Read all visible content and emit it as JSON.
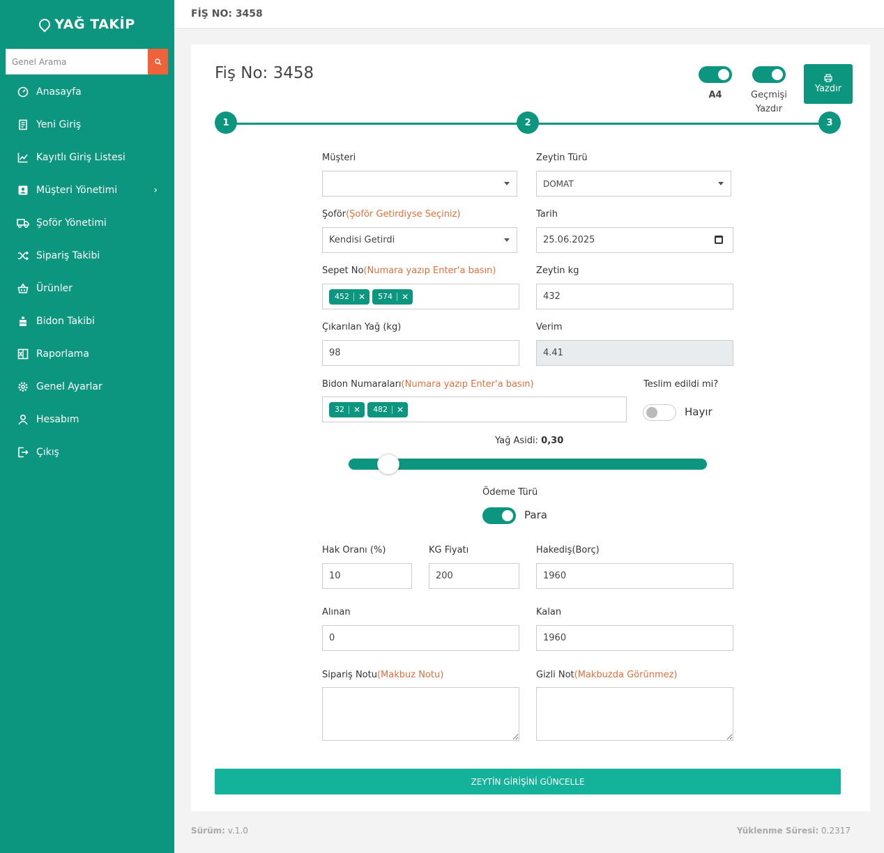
{
  "brand": {
    "name": "YAĞ TAKİP"
  },
  "search": {
    "placeholder": "Genel Arama"
  },
  "sidebar": {
    "items": [
      {
        "label": "Anasayfa",
        "icon": "dashboard-icon"
      },
      {
        "label": "Yeni Giriş",
        "icon": "receipt-icon"
      },
      {
        "label": "Kayıtlı Giriş Listesi",
        "icon": "chart-line-icon"
      },
      {
        "label": "Müşteri Yönetimi",
        "icon": "user-card-icon",
        "has_submenu": true
      },
      {
        "label": "Şoför Yönetimi",
        "icon": "truck-icon"
      },
      {
        "label": "Sipariş Takibi",
        "icon": "shuffle-icon"
      },
      {
        "label": "Ürünler",
        "icon": "basket-icon"
      },
      {
        "label": "Bidon Takibi",
        "icon": "barrel-icon"
      },
      {
        "label": "Raporlama",
        "icon": "excel-icon"
      },
      {
        "label": "Genel Ayarlar",
        "icon": "gear-icon"
      },
      {
        "label": "Hesabım",
        "icon": "user-icon"
      },
      {
        "label": "Çıkış",
        "icon": "logout-icon"
      }
    ]
  },
  "topbar": {
    "title": "FİŞ NO: 3458"
  },
  "card": {
    "title": "Fiş No: 3458",
    "toggles": {
      "a4": "A4",
      "history_l1": "Geçmişi",
      "history_l2": "Yazdır"
    },
    "print_label": "Yazdır",
    "steps": [
      "1",
      "2",
      "3"
    ]
  },
  "form": {
    "musteri": {
      "label": "Müşteri",
      "value": ""
    },
    "zeytin_turu": {
      "label": "Zeytin Türü",
      "value": "DOMAT"
    },
    "sofor": {
      "label": "Şoför",
      "hint": "(Şoför Getirdiyse Seçiniz)",
      "value": "Kendisi Getirdi"
    },
    "tarih": {
      "label": "Tarih",
      "value": "25.06.2025"
    },
    "sepet_no": {
      "label": "Sepet No",
      "hint": "(Numara yazıp Enter'a basın)",
      "tags": [
        "452",
        "574"
      ]
    },
    "zeytin_kg": {
      "label": "Zeytin kg",
      "value": "432"
    },
    "cikarilan_yag": {
      "label": "Çıkarılan Yağ (kg)",
      "value": "98"
    },
    "verim": {
      "label": "Verim",
      "value": "4.41"
    },
    "bidon": {
      "label": "Bidon Numaraları",
      "hint": "(Numara yazıp Enter'a basın)",
      "tags": [
        "32",
        "482"
      ]
    },
    "teslim": {
      "label": "Teslim edildi mi?",
      "value": "Hayır",
      "checked": false
    },
    "yag_asidi": {
      "label": "Yağ Asidi:",
      "value": "0,30",
      "level_fraction": 0.06
    },
    "odeme": {
      "label": "Ödeme Türü",
      "value": "Para",
      "checked": true
    },
    "hak_orani": {
      "label": "Hak Oranı (%)",
      "value": "10"
    },
    "kg_fiyati": {
      "label": "KG Fiyatı",
      "value": "200"
    },
    "hakedis": {
      "label": "Hakediş(Borç)",
      "value": "1960"
    },
    "alinan": {
      "label": "Alınan",
      "value": "0"
    },
    "kalan": {
      "label": "Kalan",
      "value": "1960"
    },
    "siparis_notu": {
      "label": "Sipariş Notu",
      "hint": "(Makbuz Notu)",
      "value": ""
    },
    "gizli_not": {
      "label": "Gizli Not",
      "hint": "(Makbuzda Görünmez)",
      "value": ""
    },
    "submit_label": "ZEYTİN GİRİŞİNİ GÜNCELLE"
  },
  "footer": {
    "version_label": "Sürüm:",
    "version": "v.1.0",
    "load_label": "Yüklenme Süresi:",
    "load_time": "0.2317"
  },
  "colors": {
    "primary": "#0c9680",
    "accent": "#f0623a",
    "hint": "#e0703c",
    "submit": "#14b29a"
  }
}
